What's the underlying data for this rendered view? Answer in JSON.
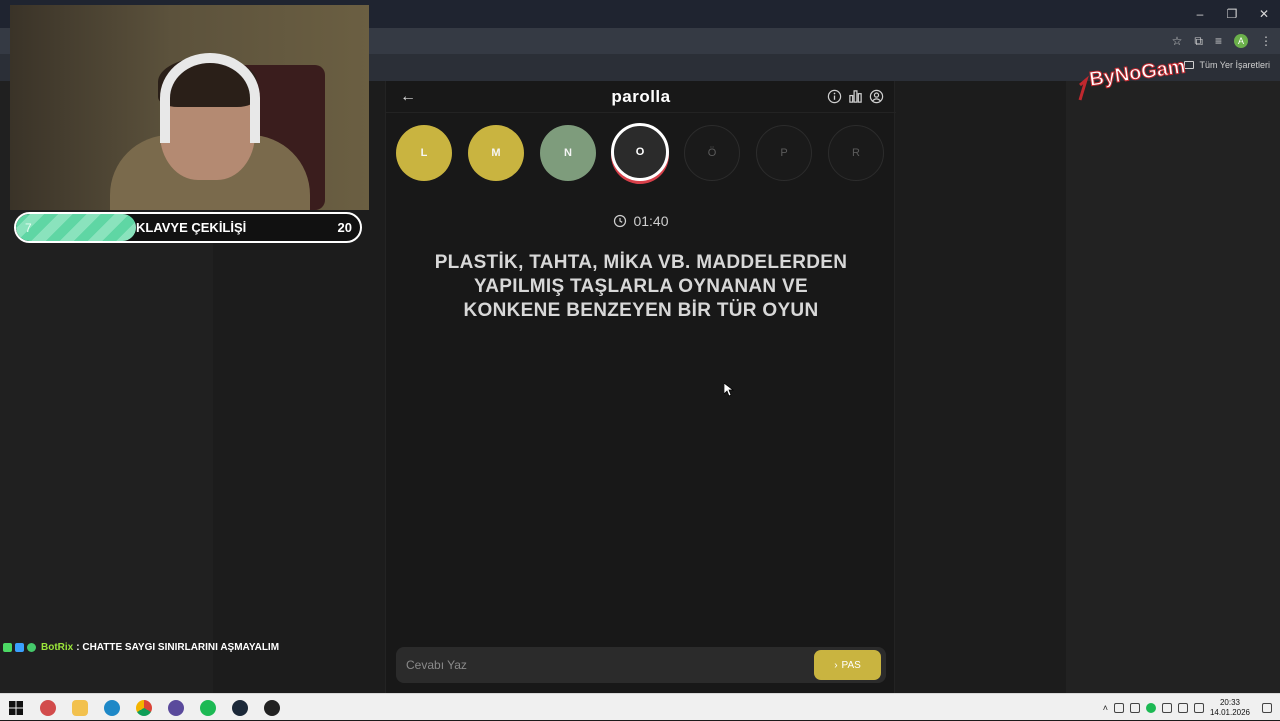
{
  "browser": {
    "bookmarks_all": "Tüm Yer İşaretleri",
    "profile_initial": "A",
    "window_controls": [
      "–",
      "❐",
      "✕"
    ]
  },
  "game": {
    "title": "parolla",
    "letters": [
      {
        "char": "L",
        "state": "correct"
      },
      {
        "char": "M",
        "state": "correct"
      },
      {
        "char": "N",
        "state": "green"
      },
      {
        "char": "O",
        "state": "active"
      },
      {
        "char": "Ö",
        "state": "idle"
      },
      {
        "char": "P",
        "state": "idle"
      },
      {
        "char": "R",
        "state": "idle"
      }
    ],
    "timer": "01:40",
    "question": "PLASTİK, TAHTA, MİKA VB. MADDELERDEN YAPILMIŞ TAŞLARLA OYNANAN VE KONKENE BENZEYEN BİR TÜR OYUN",
    "answer_placeholder": "Cevabı Yaz",
    "pass_label": "PAS",
    "colors": {
      "correct": "#c9b440",
      "green": "#7e9c7c",
      "active_ring": "#d7404a"
    }
  },
  "overlay": {
    "giveaway_label": "KLAVYE ÇEKİLİŞİ",
    "giveaway_current": "7",
    "giveaway_goal": "20",
    "giveaway_progress": 0.35,
    "chat_user": "BotRix",
    "chat_message": ": CHATTE SAYGI SINIRLARINI AŞMAYALIM",
    "logo_text": "ByNoGam"
  },
  "taskbar": {
    "time": "20:33",
    "date": "14.01.2026"
  }
}
